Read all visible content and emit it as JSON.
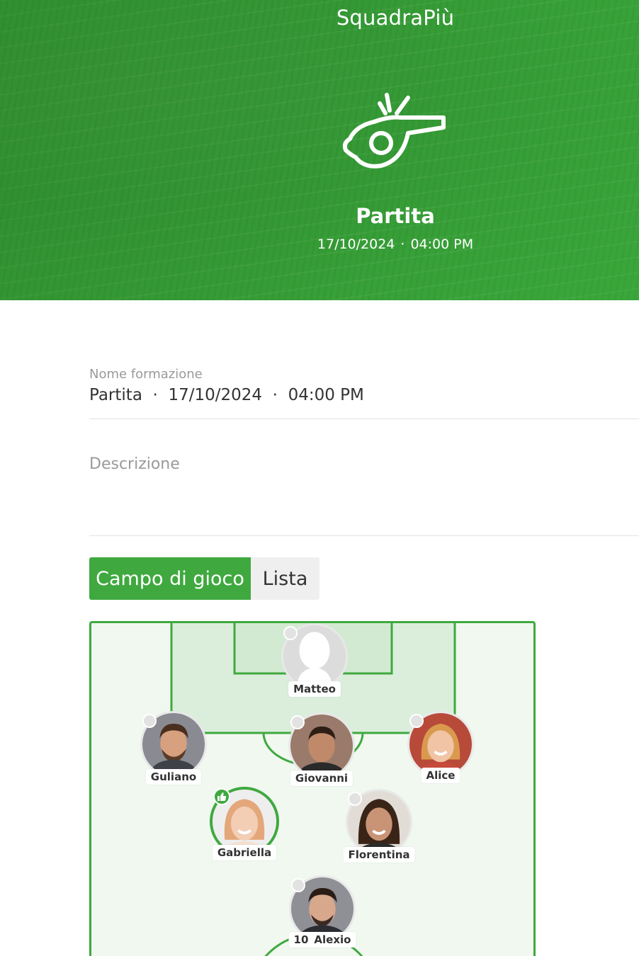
{
  "header": {
    "app_title": "SquadraPiù",
    "event_title": "Partita",
    "event_date": "17/10/2024",
    "event_time": "04:00 PM",
    "icon": "whistle-icon"
  },
  "form": {
    "name_label": "Nome formazione",
    "name_value": "Partita  ·  17/10/2024  ·  04:00 PM",
    "description_placeholder": "Descrizione"
  },
  "tabs": [
    {
      "label": "Campo di gioco",
      "active": true
    },
    {
      "label": "Lista",
      "active": false
    }
  ],
  "players": [
    {
      "name": "Matteo",
      "number": "",
      "placeholder_avatar": true
    },
    {
      "name": "Guliano",
      "number": ""
    },
    {
      "name": "Giovanni",
      "number": ""
    },
    {
      "name": "Alice",
      "number": ""
    },
    {
      "name": "Gabriella",
      "number": "",
      "liked": true
    },
    {
      "name": "Florentina",
      "number": ""
    },
    {
      "name": "Alexio",
      "number": "10"
    }
  ],
  "colors": {
    "accent": "#3fa93f",
    "banner": "#37a037",
    "pitch_bg": "#f0f8f0",
    "status_dot": "#e2e2e2"
  }
}
